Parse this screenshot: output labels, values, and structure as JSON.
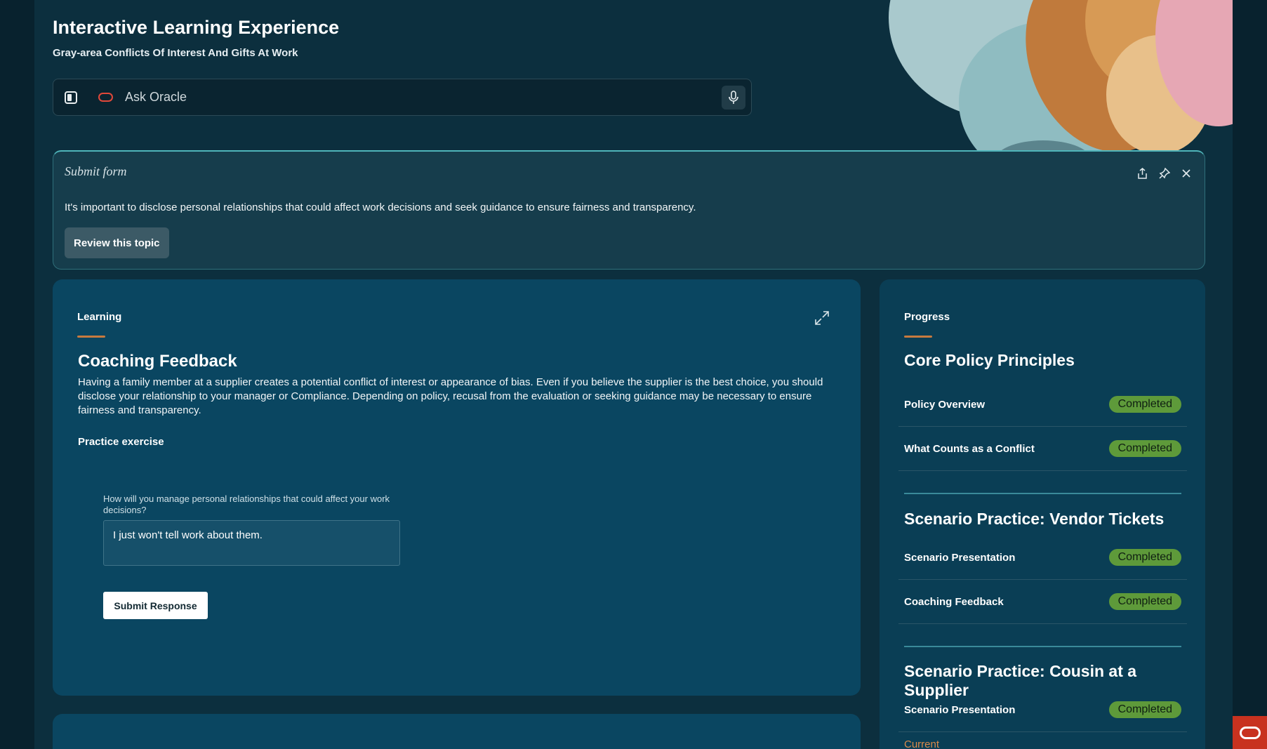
{
  "header": {
    "title": "Interactive Learning Experience",
    "subtitle": "Gray-area Conflicts Of Interest And Gifts At Work"
  },
  "ask_bar": {
    "placeholder": "Ask Oracle",
    "icons": [
      "panel-toggle-icon",
      "oracle-logo-icon",
      "microphone-icon"
    ]
  },
  "submit_card": {
    "title": "Submit form",
    "text": "It's important to disclose personal relationships that could affect work decisions and seek guidance to ensure fairness and transparency.",
    "button_label": "Review this topic",
    "actions": [
      "share-icon",
      "pin-icon",
      "close-icon"
    ]
  },
  "learning": {
    "section_label": "Learning",
    "title": "Coaching Feedback",
    "body": "Having a family member at a supplier creates a potential conflict of interest or appearance of bias. Even if you believe the supplier is the best choice, you should disclose your relationship to your manager or Compliance. Depending on policy, recusal from the evaluation or seeking guidance may be necessary to ensure fairness and transparency.",
    "practice_label": "Practice exercise",
    "question": "How will you manage personal relationships that could affect your work decisions?",
    "answer": "I just won't tell work about them.",
    "submit_label": "Submit Response"
  },
  "progress": {
    "section_label": "Progress",
    "groups": [
      {
        "title": "Core Policy Principles",
        "items": [
          {
            "label": "Policy Overview",
            "status": "Completed"
          },
          {
            "label": "What Counts as a Conflict",
            "status": "Completed"
          }
        ]
      },
      {
        "title": "Scenario Practice: Vendor Tickets",
        "items": [
          {
            "label": "Scenario Presentation",
            "status": "Completed"
          },
          {
            "label": "Coaching Feedback",
            "status": "Completed"
          }
        ]
      },
      {
        "title": "Scenario Practice: Cousin at a Supplier",
        "items": [
          {
            "label": "Scenario Presentation",
            "status": "Completed"
          }
        ]
      }
    ],
    "current_label": "Current"
  },
  "colors": {
    "background": "#0c2f3e",
    "learning_card": "#0a4661",
    "badge": "#5e9a3a",
    "accent": "#c77a3f",
    "oracle_red": "#c8321f"
  }
}
